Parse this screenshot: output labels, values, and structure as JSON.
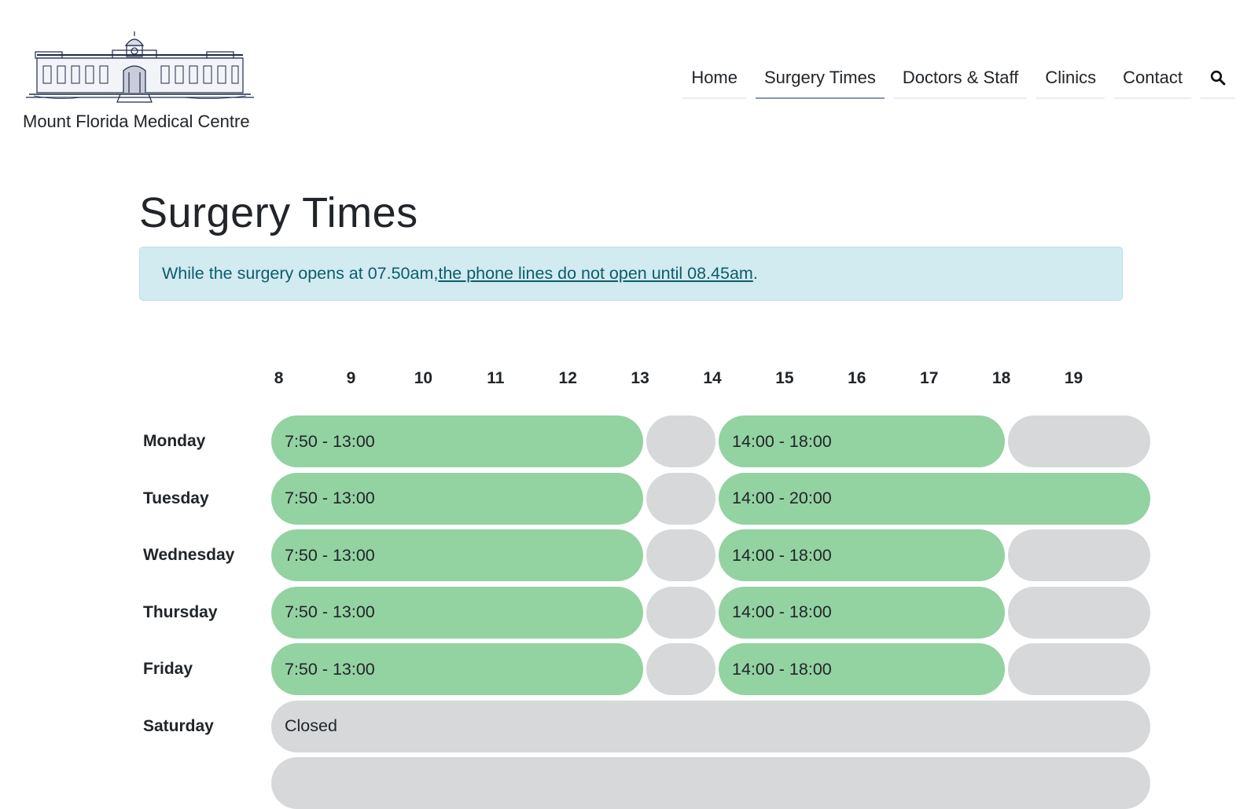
{
  "header": {
    "site_name": "Mount Florida Medical Centre",
    "logo_icon": "building-engraving-icon"
  },
  "nav": {
    "items": [
      {
        "label": "Home",
        "active": false
      },
      {
        "label": "Surgery Times",
        "active": true
      },
      {
        "label": "Doctors & Staff",
        "active": false
      },
      {
        "label": "Clinics",
        "active": false
      },
      {
        "label": "Contact",
        "active": false
      }
    ],
    "search_icon": "search-icon"
  },
  "main": {
    "title": "Surgery Times",
    "alert": {
      "text_before": "While the surgery opens at 07.50am, ",
      "link_text": "the phone lines do not open until 08.45am",
      "text_after": "."
    }
  },
  "timetable": {
    "hours": [
      "8",
      "9",
      "10",
      "11",
      "12",
      "13",
      "14",
      "15",
      "16",
      "17",
      "18",
      "19"
    ],
    "colors": {
      "open": "#93d2a1",
      "closed": "#d6d8da",
      "alert_bg": "#d1ebf0",
      "alert_text": "#0e5c6b"
    },
    "days": [
      {
        "day": "Monday",
        "slots": [
          {
            "start": 7.83,
            "end": 13,
            "label": "7:50 - 13:00",
            "open": true
          },
          {
            "start": 13,
            "end": 14,
            "label": "",
            "open": false
          },
          {
            "start": 14,
            "end": 18,
            "label": "14:00 - 18:00",
            "open": true
          },
          {
            "start": 18,
            "end": 20,
            "label": "",
            "open": false
          }
        ]
      },
      {
        "day": "Tuesday",
        "slots": [
          {
            "start": 7.83,
            "end": 13,
            "label": "7:50 - 13:00",
            "open": true
          },
          {
            "start": 13,
            "end": 14,
            "label": "",
            "open": false
          },
          {
            "start": 14,
            "end": 20,
            "label": "14:00 - 20:00",
            "open": true
          }
        ]
      },
      {
        "day": "Wednesday",
        "slots": [
          {
            "start": 7.83,
            "end": 13,
            "label": "7:50 - 13:00",
            "open": true
          },
          {
            "start": 13,
            "end": 14,
            "label": "",
            "open": false
          },
          {
            "start": 14,
            "end": 18,
            "label": "14:00 - 18:00",
            "open": true
          },
          {
            "start": 18,
            "end": 20,
            "label": "",
            "open": false
          }
        ]
      },
      {
        "day": "Thursday",
        "slots": [
          {
            "start": 7.83,
            "end": 13,
            "label": "7:50 - 13:00",
            "open": true
          },
          {
            "start": 13,
            "end": 14,
            "label": "",
            "open": false
          },
          {
            "start": 14,
            "end": 18,
            "label": "14:00 - 18:00",
            "open": true
          },
          {
            "start": 18,
            "end": 20,
            "label": "",
            "open": false
          }
        ]
      },
      {
        "day": "Friday",
        "slots": [
          {
            "start": 7.83,
            "end": 13,
            "label": "7:50 - 13:00",
            "open": true
          },
          {
            "start": 13,
            "end": 14,
            "label": "",
            "open": false
          },
          {
            "start": 14,
            "end": 18,
            "label": "14:00 - 18:00",
            "open": true
          },
          {
            "start": 18,
            "end": 20,
            "label": "",
            "open": false
          }
        ]
      },
      {
        "day": "Saturday",
        "slots": [
          {
            "start": 7.83,
            "end": 20,
            "label": "Closed",
            "open": false
          }
        ]
      },
      {
        "day": "",
        "slots": [
          {
            "start": 7.83,
            "end": 20,
            "label": "",
            "open": false
          }
        ]
      }
    ]
  }
}
